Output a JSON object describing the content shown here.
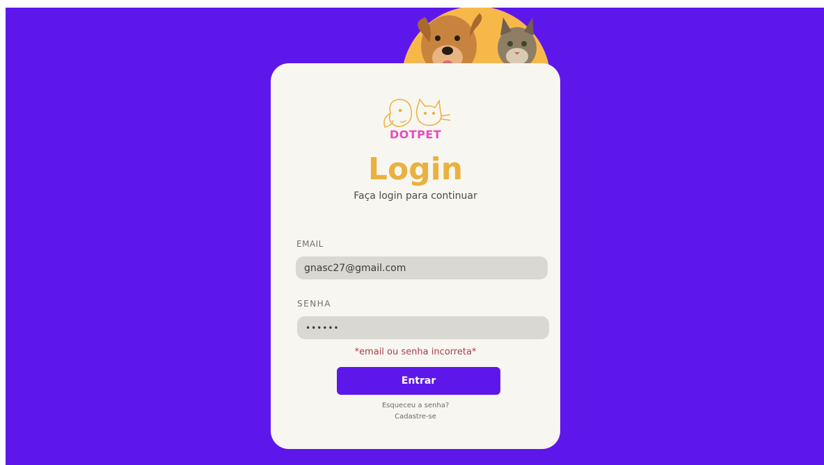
{
  "brand": {
    "name": "DOTPET"
  },
  "login": {
    "title": "Login",
    "subtitle": "Faça login para continuar",
    "email_label": "EMAIL",
    "email_value": "gnasc27@gmail.com",
    "password_label": "SENHA",
    "password_value": "••••••",
    "error_message": "*email ou senha incorreta*",
    "submit_label": "Entrar",
    "forgot_link": "Esqueceu a senha?",
    "signup_link": "Cadastre-se"
  },
  "colors": {
    "background": "#5e17eb",
    "card": "#f8f6f0",
    "accent_yellow": "#e9b13f",
    "brand_pink": "#e54cc1",
    "button": "#5e17eb",
    "error": "#a8404b",
    "input_bg": "#d9d8d3"
  },
  "icons": {
    "header_illustration": "dog-and-cat-illustration",
    "logo": "dog-cat-outline-logo"
  }
}
